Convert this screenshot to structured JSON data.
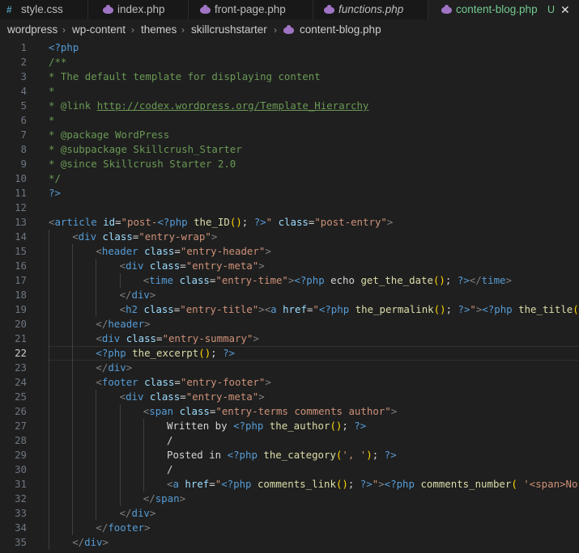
{
  "tabs": [
    {
      "label": "style.css",
      "icon": "#",
      "icon_name": "hash-icon",
      "italic": false,
      "active": false
    },
    {
      "label": "index.php",
      "icon": "",
      "icon_name": "php-elephant-icon",
      "italic": false,
      "active": false
    },
    {
      "label": "front-page.php",
      "icon": "",
      "icon_name": "php-elephant-icon",
      "italic": false,
      "active": false
    },
    {
      "label": "functions.php",
      "icon": "",
      "icon_name": "php-elephant-icon",
      "italic": true,
      "active": false
    },
    {
      "label": "content-blog.php",
      "icon": "",
      "icon_name": "php-elephant-icon",
      "italic": false,
      "active": true,
      "status": "U",
      "close": "✕"
    }
  ],
  "breadcrumb": [
    "wordpress",
    "wp-content",
    "themes",
    "skillcrushstarter",
    "content-blog.php"
  ],
  "current_line": 22,
  "colors": {
    "background": "#1f1f1f",
    "tag": "#569cd6",
    "attribute": "#9cdcfe",
    "string": "#ce9178",
    "function": "#dcdcaa",
    "comment": "#6a9955",
    "modified": "#73c991"
  },
  "lines": [
    {
      "n": "1",
      "indent": 0,
      "t": [
        [
          "php",
          "<?php"
        ]
      ]
    },
    {
      "n": "2",
      "indent": 0,
      "t": [
        [
          "cm",
          "/**"
        ]
      ]
    },
    {
      "n": "3",
      "indent": 0,
      "t": [
        [
          "cm",
          "* The default template for displaying content"
        ]
      ]
    },
    {
      "n": "4",
      "indent": 0,
      "t": [
        [
          "cm",
          "*"
        ]
      ]
    },
    {
      "n": "5",
      "indent": 0,
      "t": [
        [
          "cm",
          "* @link "
        ],
        [
          "cmlink",
          "http://codex.wordpress.org/Template_Hierarchy"
        ]
      ]
    },
    {
      "n": "6",
      "indent": 0,
      "t": [
        [
          "cm",
          "*"
        ]
      ]
    },
    {
      "n": "7",
      "indent": 0,
      "t": [
        [
          "cm",
          "* @package WordPress"
        ]
      ]
    },
    {
      "n": "8",
      "indent": 0,
      "t": [
        [
          "cm",
          "* @subpackage Skillcrush_Starter"
        ]
      ]
    },
    {
      "n": "9",
      "indent": 0,
      "t": [
        [
          "cm",
          "* @since Skillcrush Starter 2.0"
        ]
      ]
    },
    {
      "n": "10",
      "indent": 0,
      "t": [
        [
          "cm",
          "*/"
        ]
      ]
    },
    {
      "n": "11",
      "indent": 0,
      "t": [
        [
          "php",
          "?>"
        ]
      ]
    },
    {
      "n": "12",
      "indent": 0,
      "t": []
    },
    {
      "n": "13",
      "indent": 0,
      "t": [
        [
          "ang",
          "<"
        ],
        [
          "tag",
          "article"
        ],
        [
          "txt",
          " "
        ],
        [
          "attr",
          "id"
        ],
        [
          "txt",
          "="
        ],
        [
          "str",
          "\"post-"
        ],
        [
          "php",
          "<?php"
        ],
        [
          "txt",
          " "
        ],
        [
          "fn",
          "the_ID"
        ],
        [
          "brace",
          "()"
        ],
        [
          "txt",
          "; "
        ],
        [
          "php",
          "?>"
        ],
        [
          "str",
          "\""
        ],
        [
          "txt",
          " "
        ],
        [
          "attr",
          "class"
        ],
        [
          "txt",
          "="
        ],
        [
          "str",
          "\"post-entry\""
        ],
        [
          "ang",
          ">"
        ]
      ]
    },
    {
      "n": "14",
      "indent": 1,
      "t": [
        [
          "ang",
          "<"
        ],
        [
          "tag",
          "div"
        ],
        [
          "txt",
          " "
        ],
        [
          "attr",
          "class"
        ],
        [
          "txt",
          "="
        ],
        [
          "str",
          "\"entry-wrap\""
        ],
        [
          "ang",
          ">"
        ]
      ]
    },
    {
      "n": "15",
      "indent": 2,
      "t": [
        [
          "ang",
          "<"
        ],
        [
          "tag",
          "header"
        ],
        [
          "txt",
          " "
        ],
        [
          "attr",
          "class"
        ],
        [
          "txt",
          "="
        ],
        [
          "str",
          "\"entry-header\""
        ],
        [
          "ang",
          ">"
        ]
      ]
    },
    {
      "n": "16",
      "indent": 3,
      "t": [
        [
          "ang",
          "<"
        ],
        [
          "tag",
          "div"
        ],
        [
          "txt",
          " "
        ],
        [
          "attr",
          "class"
        ],
        [
          "txt",
          "="
        ],
        [
          "str",
          "\"entry-meta\""
        ],
        [
          "ang",
          ">"
        ]
      ]
    },
    {
      "n": "17",
      "indent": 4,
      "t": [
        [
          "ang",
          "<"
        ],
        [
          "tag",
          "time"
        ],
        [
          "txt",
          " "
        ],
        [
          "attr",
          "class"
        ],
        [
          "txt",
          "="
        ],
        [
          "str",
          "\"entry-time\""
        ],
        [
          "ang",
          ">"
        ],
        [
          "php",
          "<?php"
        ],
        [
          "txt",
          " echo "
        ],
        [
          "fn",
          "get_the_date"
        ],
        [
          "brace",
          "()"
        ],
        [
          "txt",
          "; "
        ],
        [
          "php",
          "?>"
        ],
        [
          "ang",
          "</"
        ],
        [
          "tag",
          "time"
        ],
        [
          "ang",
          ">"
        ]
      ]
    },
    {
      "n": "18",
      "indent": 3,
      "t": [
        [
          "ang",
          "</"
        ],
        [
          "tag",
          "div"
        ],
        [
          "ang",
          ">"
        ]
      ]
    },
    {
      "n": "19",
      "indent": 3,
      "t": [
        [
          "ang",
          "<"
        ],
        [
          "tag",
          "h2"
        ],
        [
          "txt",
          " "
        ],
        [
          "attr",
          "class"
        ],
        [
          "txt",
          "="
        ],
        [
          "str",
          "\"entry-title\""
        ],
        [
          "ang",
          ">"
        ],
        [
          "ang",
          "<"
        ],
        [
          "tag",
          "a"
        ],
        [
          "txt",
          " "
        ],
        [
          "attr",
          "href"
        ],
        [
          "txt",
          "="
        ],
        [
          "str",
          "\""
        ],
        [
          "php",
          "<?php"
        ],
        [
          "txt",
          " "
        ],
        [
          "fn",
          "the_permalink"
        ],
        [
          "brace",
          "()"
        ],
        [
          "txt",
          "; "
        ],
        [
          "php",
          "?>"
        ],
        [
          "str",
          "\""
        ],
        [
          "ang",
          ">"
        ],
        [
          "php",
          "<?php"
        ],
        [
          "txt",
          " "
        ],
        [
          "fn",
          "the_title"
        ],
        [
          "brace",
          "()"
        ],
        [
          "txt",
          ";"
        ]
      ]
    },
    {
      "n": "20",
      "indent": 2,
      "t": [
        [
          "ang",
          "</"
        ],
        [
          "tag",
          "header"
        ],
        [
          "ang",
          ">"
        ]
      ]
    },
    {
      "n": "21",
      "indent": 2,
      "t": [
        [
          "ang",
          "<"
        ],
        [
          "tag",
          "div"
        ],
        [
          "txt",
          " "
        ],
        [
          "attr",
          "class"
        ],
        [
          "txt",
          "="
        ],
        [
          "str",
          "\"entry-summary\""
        ],
        [
          "ang",
          ">"
        ]
      ]
    },
    {
      "n": "22",
      "indent": 2,
      "t": [
        [
          "php",
          "<?php"
        ],
        [
          "txt",
          " "
        ],
        [
          "fn",
          "the_excerpt"
        ],
        [
          "brace",
          "()"
        ],
        [
          "txt",
          "; "
        ],
        [
          "php",
          "?>"
        ]
      ]
    },
    {
      "n": "23",
      "indent": 2,
      "t": [
        [
          "ang",
          "</"
        ],
        [
          "tag",
          "div"
        ],
        [
          "ang",
          ">"
        ]
      ]
    },
    {
      "n": "24",
      "indent": 2,
      "t": [
        [
          "ang",
          "<"
        ],
        [
          "tag",
          "footer"
        ],
        [
          "txt",
          " "
        ],
        [
          "attr",
          "class"
        ],
        [
          "txt",
          "="
        ],
        [
          "str",
          "\"entry-footer\""
        ],
        [
          "ang",
          ">"
        ]
      ]
    },
    {
      "n": "25",
      "indent": 3,
      "t": [
        [
          "ang",
          "<"
        ],
        [
          "tag",
          "div"
        ],
        [
          "txt",
          " "
        ],
        [
          "attr",
          "class"
        ],
        [
          "txt",
          "="
        ],
        [
          "str",
          "\"entry-meta\""
        ],
        [
          "ang",
          ">"
        ]
      ]
    },
    {
      "n": "26",
      "indent": 4,
      "t": [
        [
          "ang",
          "<"
        ],
        [
          "tag",
          "span"
        ],
        [
          "txt",
          " "
        ],
        [
          "attr",
          "class"
        ],
        [
          "txt",
          "="
        ],
        [
          "str",
          "\"entry-terms comments author\""
        ],
        [
          "ang",
          ">"
        ]
      ]
    },
    {
      "n": "27",
      "indent": 5,
      "t": [
        [
          "txt",
          "Written by "
        ],
        [
          "php",
          "<?php"
        ],
        [
          "txt",
          " "
        ],
        [
          "fn",
          "the_author"
        ],
        [
          "brace",
          "()"
        ],
        [
          "txt",
          "; "
        ],
        [
          "php",
          "?>"
        ]
      ]
    },
    {
      "n": "28",
      "indent": 5,
      "t": [
        [
          "txt",
          "/"
        ]
      ]
    },
    {
      "n": "29",
      "indent": 5,
      "t": [
        [
          "txt",
          "Posted in "
        ],
        [
          "php",
          "<?php"
        ],
        [
          "txt",
          " "
        ],
        [
          "fn",
          "the_category"
        ],
        [
          "brace",
          "("
        ],
        [
          "str",
          "', '"
        ],
        [
          "brace",
          ")"
        ],
        [
          "txt",
          "; "
        ],
        [
          "php",
          "?>"
        ]
      ]
    },
    {
      "n": "30",
      "indent": 5,
      "t": [
        [
          "txt",
          "/"
        ]
      ]
    },
    {
      "n": "31",
      "indent": 5,
      "t": [
        [
          "ang",
          "<"
        ],
        [
          "tag",
          "a"
        ],
        [
          "txt",
          " "
        ],
        [
          "attr",
          "href"
        ],
        [
          "txt",
          "="
        ],
        [
          "str",
          "\""
        ],
        [
          "php",
          "<?php"
        ],
        [
          "txt",
          " "
        ],
        [
          "fn",
          "comments_link"
        ],
        [
          "brace",
          "()"
        ],
        [
          "txt",
          "; "
        ],
        [
          "php",
          "?>"
        ],
        [
          "str",
          "\""
        ],
        [
          "ang",
          ">"
        ],
        [
          "php",
          "<?php"
        ],
        [
          "txt",
          " "
        ],
        [
          "fn",
          "comments_number"
        ],
        [
          "brace",
          "("
        ],
        [
          "txt",
          " "
        ],
        [
          "str",
          "'<span>No Co"
        ]
      ]
    },
    {
      "n": "32",
      "indent": 4,
      "t": [
        [
          "ang",
          "</"
        ],
        [
          "tag",
          "span"
        ],
        [
          "ang",
          ">"
        ]
      ]
    },
    {
      "n": "33",
      "indent": 3,
      "t": [
        [
          "ang",
          "</"
        ],
        [
          "tag",
          "div"
        ],
        [
          "ang",
          ">"
        ]
      ]
    },
    {
      "n": "34",
      "indent": 2,
      "t": [
        [
          "ang",
          "</"
        ],
        [
          "tag",
          "footer"
        ],
        [
          "ang",
          ">"
        ]
      ]
    },
    {
      "n": "35",
      "indent": 1,
      "t": [
        [
          "ang",
          "</"
        ],
        [
          "tag",
          "div"
        ],
        [
          "ang",
          ">"
        ]
      ]
    }
  ]
}
